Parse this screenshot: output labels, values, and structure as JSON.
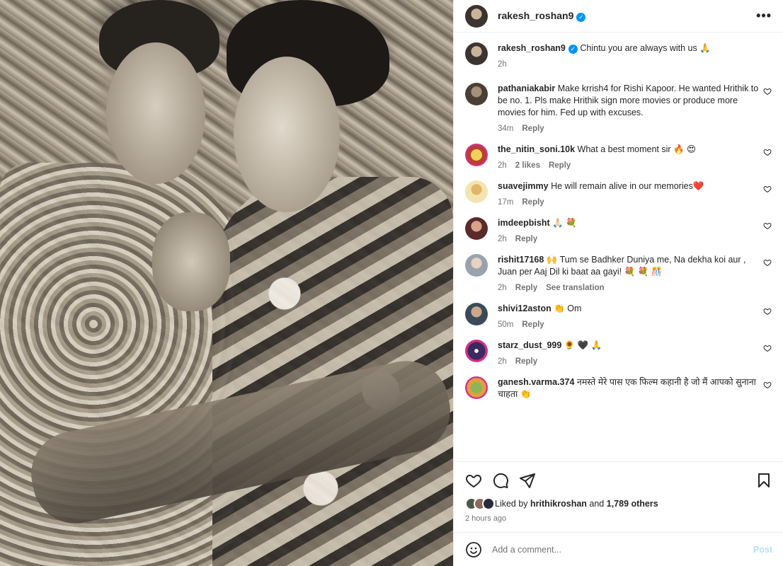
{
  "post": {
    "username": "rakesh_roshan9",
    "more": "•••"
  },
  "caption": {
    "username": "rakesh_roshan9",
    "text": "Chintu you are always with us 🙏",
    "time": "2h"
  },
  "comments": [
    {
      "username": "pathaniakabir",
      "text": "Make krrish4 for Rishi Kapoor. He wanted Hrithik to be no. 1. Pls make Hrithik sign more movies or produce more movies for him. Fed up with excuses.",
      "time": "34m",
      "likes": "",
      "reply": "Reply",
      "translate": ""
    },
    {
      "username": "the_nitin_soni.10k",
      "text": "What a best moment sir 🔥 😍",
      "time": "2h",
      "likes": "2 likes",
      "reply": "Reply",
      "translate": ""
    },
    {
      "username": "suavejimmy",
      "text": "He will remain alive in our memories❤️",
      "time": "17m",
      "likes": "",
      "reply": "Reply",
      "translate": ""
    },
    {
      "username": "imdeepbisht",
      "text": "🙏🏻 💐",
      "time": "2h",
      "likes": "",
      "reply": "Reply",
      "translate": ""
    },
    {
      "username": "rishit17168",
      "text": "🙌 Tum se Badhker Duniya me, Na dekha koi aur , Juan per Aaj Dil ki baat aa gayi! 💐 💐 🎊",
      "time": "2h",
      "likes": "",
      "reply": "Reply",
      "translate": "See translation"
    },
    {
      "username": "shivi12aston",
      "text": "👏 Om",
      "time": "50m",
      "likes": "",
      "reply": "Reply",
      "translate": ""
    },
    {
      "username": "starz_dust_999",
      "text": "🌻 🖤 🙏",
      "time": "2h",
      "likes": "",
      "reply": "Reply",
      "translate": ""
    },
    {
      "username": "ganesh.varma.374",
      "text": "नमस्ते मेरे पास एक फिल्म कहानी है जो मैं आपको सुनाना चाहता 👏",
      "time": "",
      "likes": "",
      "reply": "",
      "translate": ""
    }
  ],
  "likes": {
    "prefix": "Liked by",
    "user": "hrithikroshan",
    "and": "and",
    "others": "1,789 others",
    "ago": "2 hours ago"
  },
  "add_comment": {
    "placeholder": "Add a comment...",
    "post": "Post"
  },
  "colors": {
    "accent": "#0095f6",
    "post_disabled": "#b2dffc",
    "muted": "#737373"
  }
}
